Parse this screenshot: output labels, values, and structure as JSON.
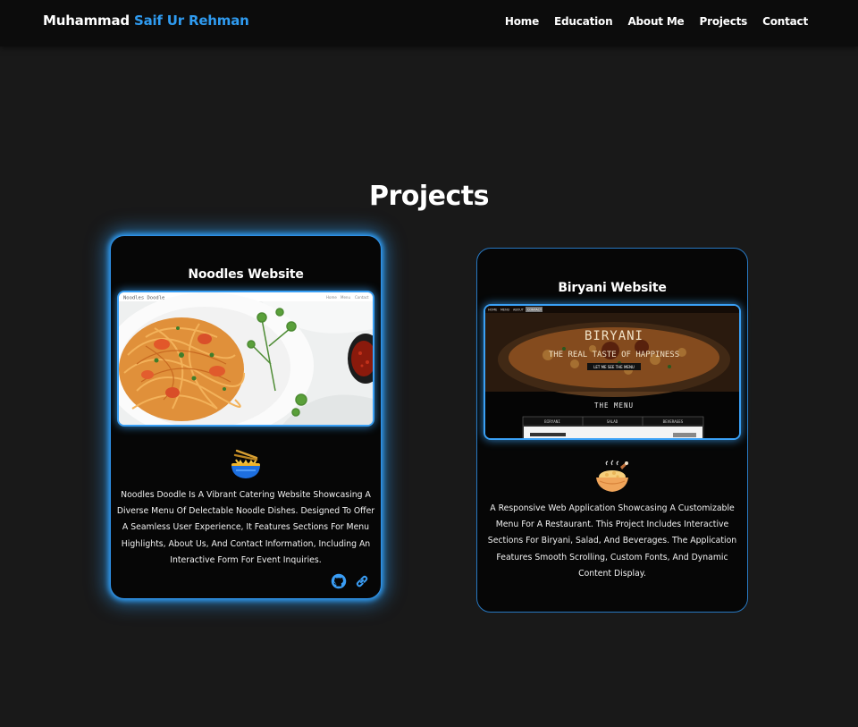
{
  "nav": {
    "brand_first": "Muhammad",
    "brand_accent": "Saif Ur Rehman",
    "links": [
      "Home",
      "Education",
      "About Me",
      "Projects",
      "Contact"
    ]
  },
  "section": {
    "title": "Projects"
  },
  "projects": [
    {
      "title": "Noodles Website",
      "screenshot_header": {
        "logo": "Noodles Doodle",
        "links": [
          "Home",
          "Menu",
          "Contact"
        ]
      },
      "icon": "noodle-bowl-icon",
      "description": "Noodles Doodle Is A Vibrant Catering Website Showcasing A Diverse Menu Of Delectable Noodle Dishes. Designed To Offer A Seamless User Experience, It Features Sections For Menu Highlights, About Us, And Contact Information, Including An Interactive Form For Event Inquiries.",
      "links": [
        "github-icon",
        "link-icon"
      ]
    },
    {
      "title": "Biryani Website",
      "screenshot_header": {
        "links": [
          "HOME",
          "MENU",
          "ABOUT",
          "CONTACT"
        ],
        "hero_title": "BIRYANI",
        "hero_subtitle": "THE REAL TASTE OF HAPPINESS",
        "hero_button": "LET ME SEE THE MENU",
        "menu_heading": "THE MENU",
        "menu_tabs": [
          "BIRYANI",
          "SALAD",
          "BEVERAGES"
        ]
      },
      "icon": "biryani-dish-icon",
      "description": "A Responsive Web Application Showcasing A Customizable Menu For A Restaurant. This Project Includes Interactive Sections For Biryani, Salad, And Beverages. The Application Features Smooth Scrolling, Custom Fonts, And Dynamic Content Display."
    }
  ],
  "colors": {
    "background": "#191919",
    "navbar": "#0c0c0c",
    "accent": "#2f9bf0",
    "card": "#060606"
  }
}
